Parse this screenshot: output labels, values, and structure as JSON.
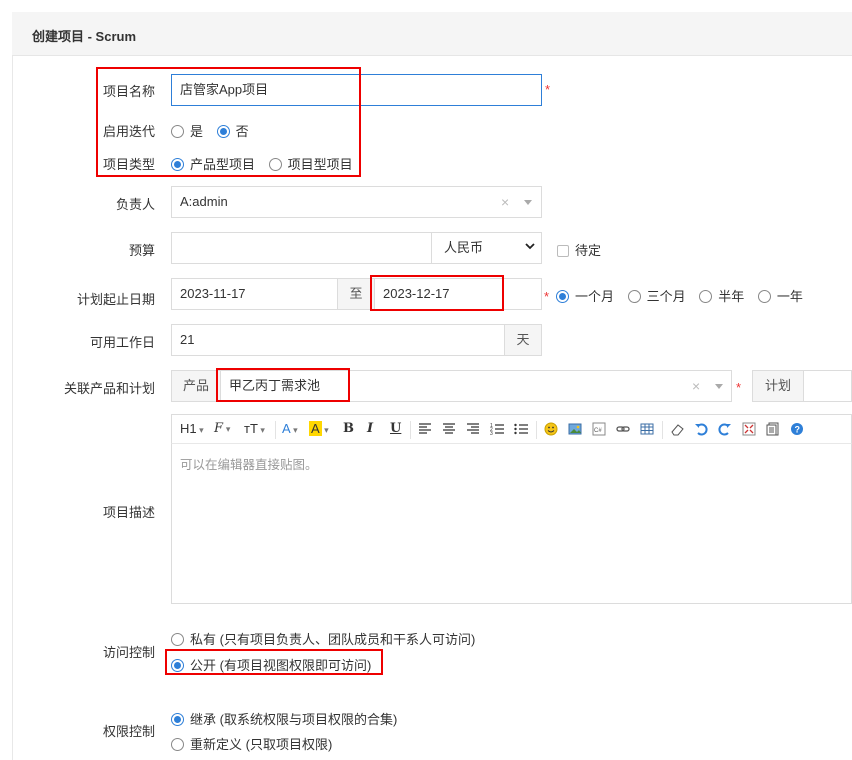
{
  "header": {
    "title": "创建项目 - Scrum"
  },
  "form": {
    "name": {
      "label": "项目名称",
      "value": "店管家App项目",
      "required": "*"
    },
    "iteration": {
      "label": "启用迭代",
      "options": [
        "是",
        "否"
      ],
      "selected": 1
    },
    "type": {
      "label": "项目类型",
      "options": [
        "产品型项目",
        "项目型项目"
      ],
      "selected": 0
    },
    "owner": {
      "label": "负责人",
      "value": "A:admin"
    },
    "budget": {
      "label": "预算",
      "value": "",
      "currency": "人民币",
      "tbd_label": "待定"
    },
    "dates": {
      "label": "计划起止日期",
      "start": "2023-11-17",
      "to": "至",
      "end": "2023-12-17",
      "required": "*",
      "options": [
        "一个月",
        "三个月",
        "半年",
        "一年"
      ],
      "selected": 0
    },
    "workdays": {
      "label": "可用工作日",
      "value": "21",
      "unit": "天"
    },
    "product": {
      "label": "关联产品和计划",
      "prefix": "产品",
      "value": "甲乙丙丁需求池",
      "required": "*",
      "plan_label": "计划"
    },
    "description": {
      "label": "项目描述",
      "placeholder": "可以在编辑器直接贴图。"
    },
    "access": {
      "label": "访问控制",
      "options": [
        "私有 (只有项目负责人、团队成员和干系人可访问)",
        "公开 (有项目视图权限即可访问)"
      ],
      "selected": 1
    },
    "permission": {
      "label": "权限控制",
      "options": [
        "继承 (取系统权限与项目权限的合集)",
        "重新定义 (只取项目权限)"
      ],
      "selected": 0
    }
  },
  "toolbar": {
    "heading": "H1",
    "font": "F",
    "size": "тT",
    "fontcolor": "A",
    "bgcolor": "A",
    "bold": "B",
    "italic": "I",
    "underline": "U"
  },
  "colors": {
    "accent": "#2e7fd8",
    "highlight_box": "#e00000",
    "required": "#e33333"
  }
}
